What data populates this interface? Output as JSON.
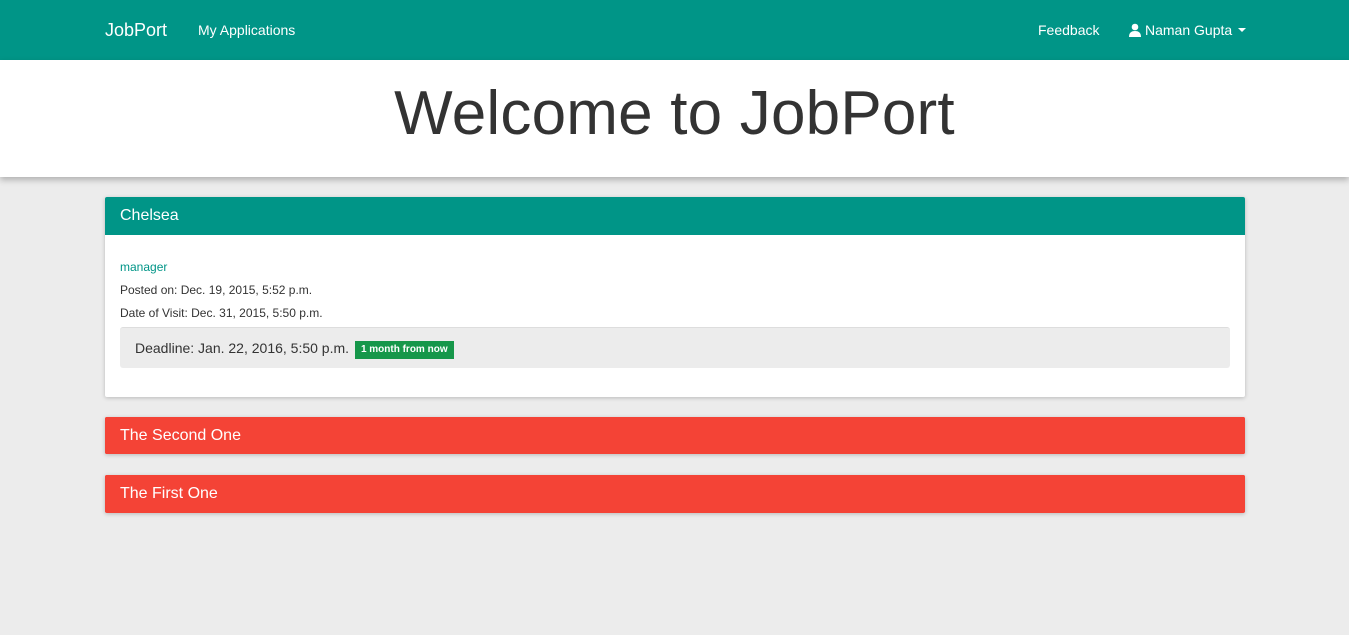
{
  "navbar": {
    "brand": "JobPort",
    "my_applications": "My Applications",
    "feedback": "Feedback",
    "user_name": "Naman Gupta"
  },
  "jumbotron": {
    "title": "Welcome to JobPort"
  },
  "colors": {
    "primary": "#009587",
    "danger": "#f44336",
    "success_badge": "#16974a",
    "background": "#ececec"
  },
  "panels": [
    {
      "title": "Chelsea",
      "status": "expanded",
      "role": "manager",
      "posted_on": "Posted on: Dec. 19, 2015, 5:52 p.m.",
      "date_of_visit": "Date of Visit: Dec. 31, 2015, 5:50 p.m.",
      "deadline": "Deadline: Jan. 22, 2016, 5:50 p.m.",
      "deadline_badge": "1 month from now"
    },
    {
      "title": "The Second One",
      "status": "collapsed"
    },
    {
      "title": "The First One",
      "status": "collapsed"
    }
  ]
}
